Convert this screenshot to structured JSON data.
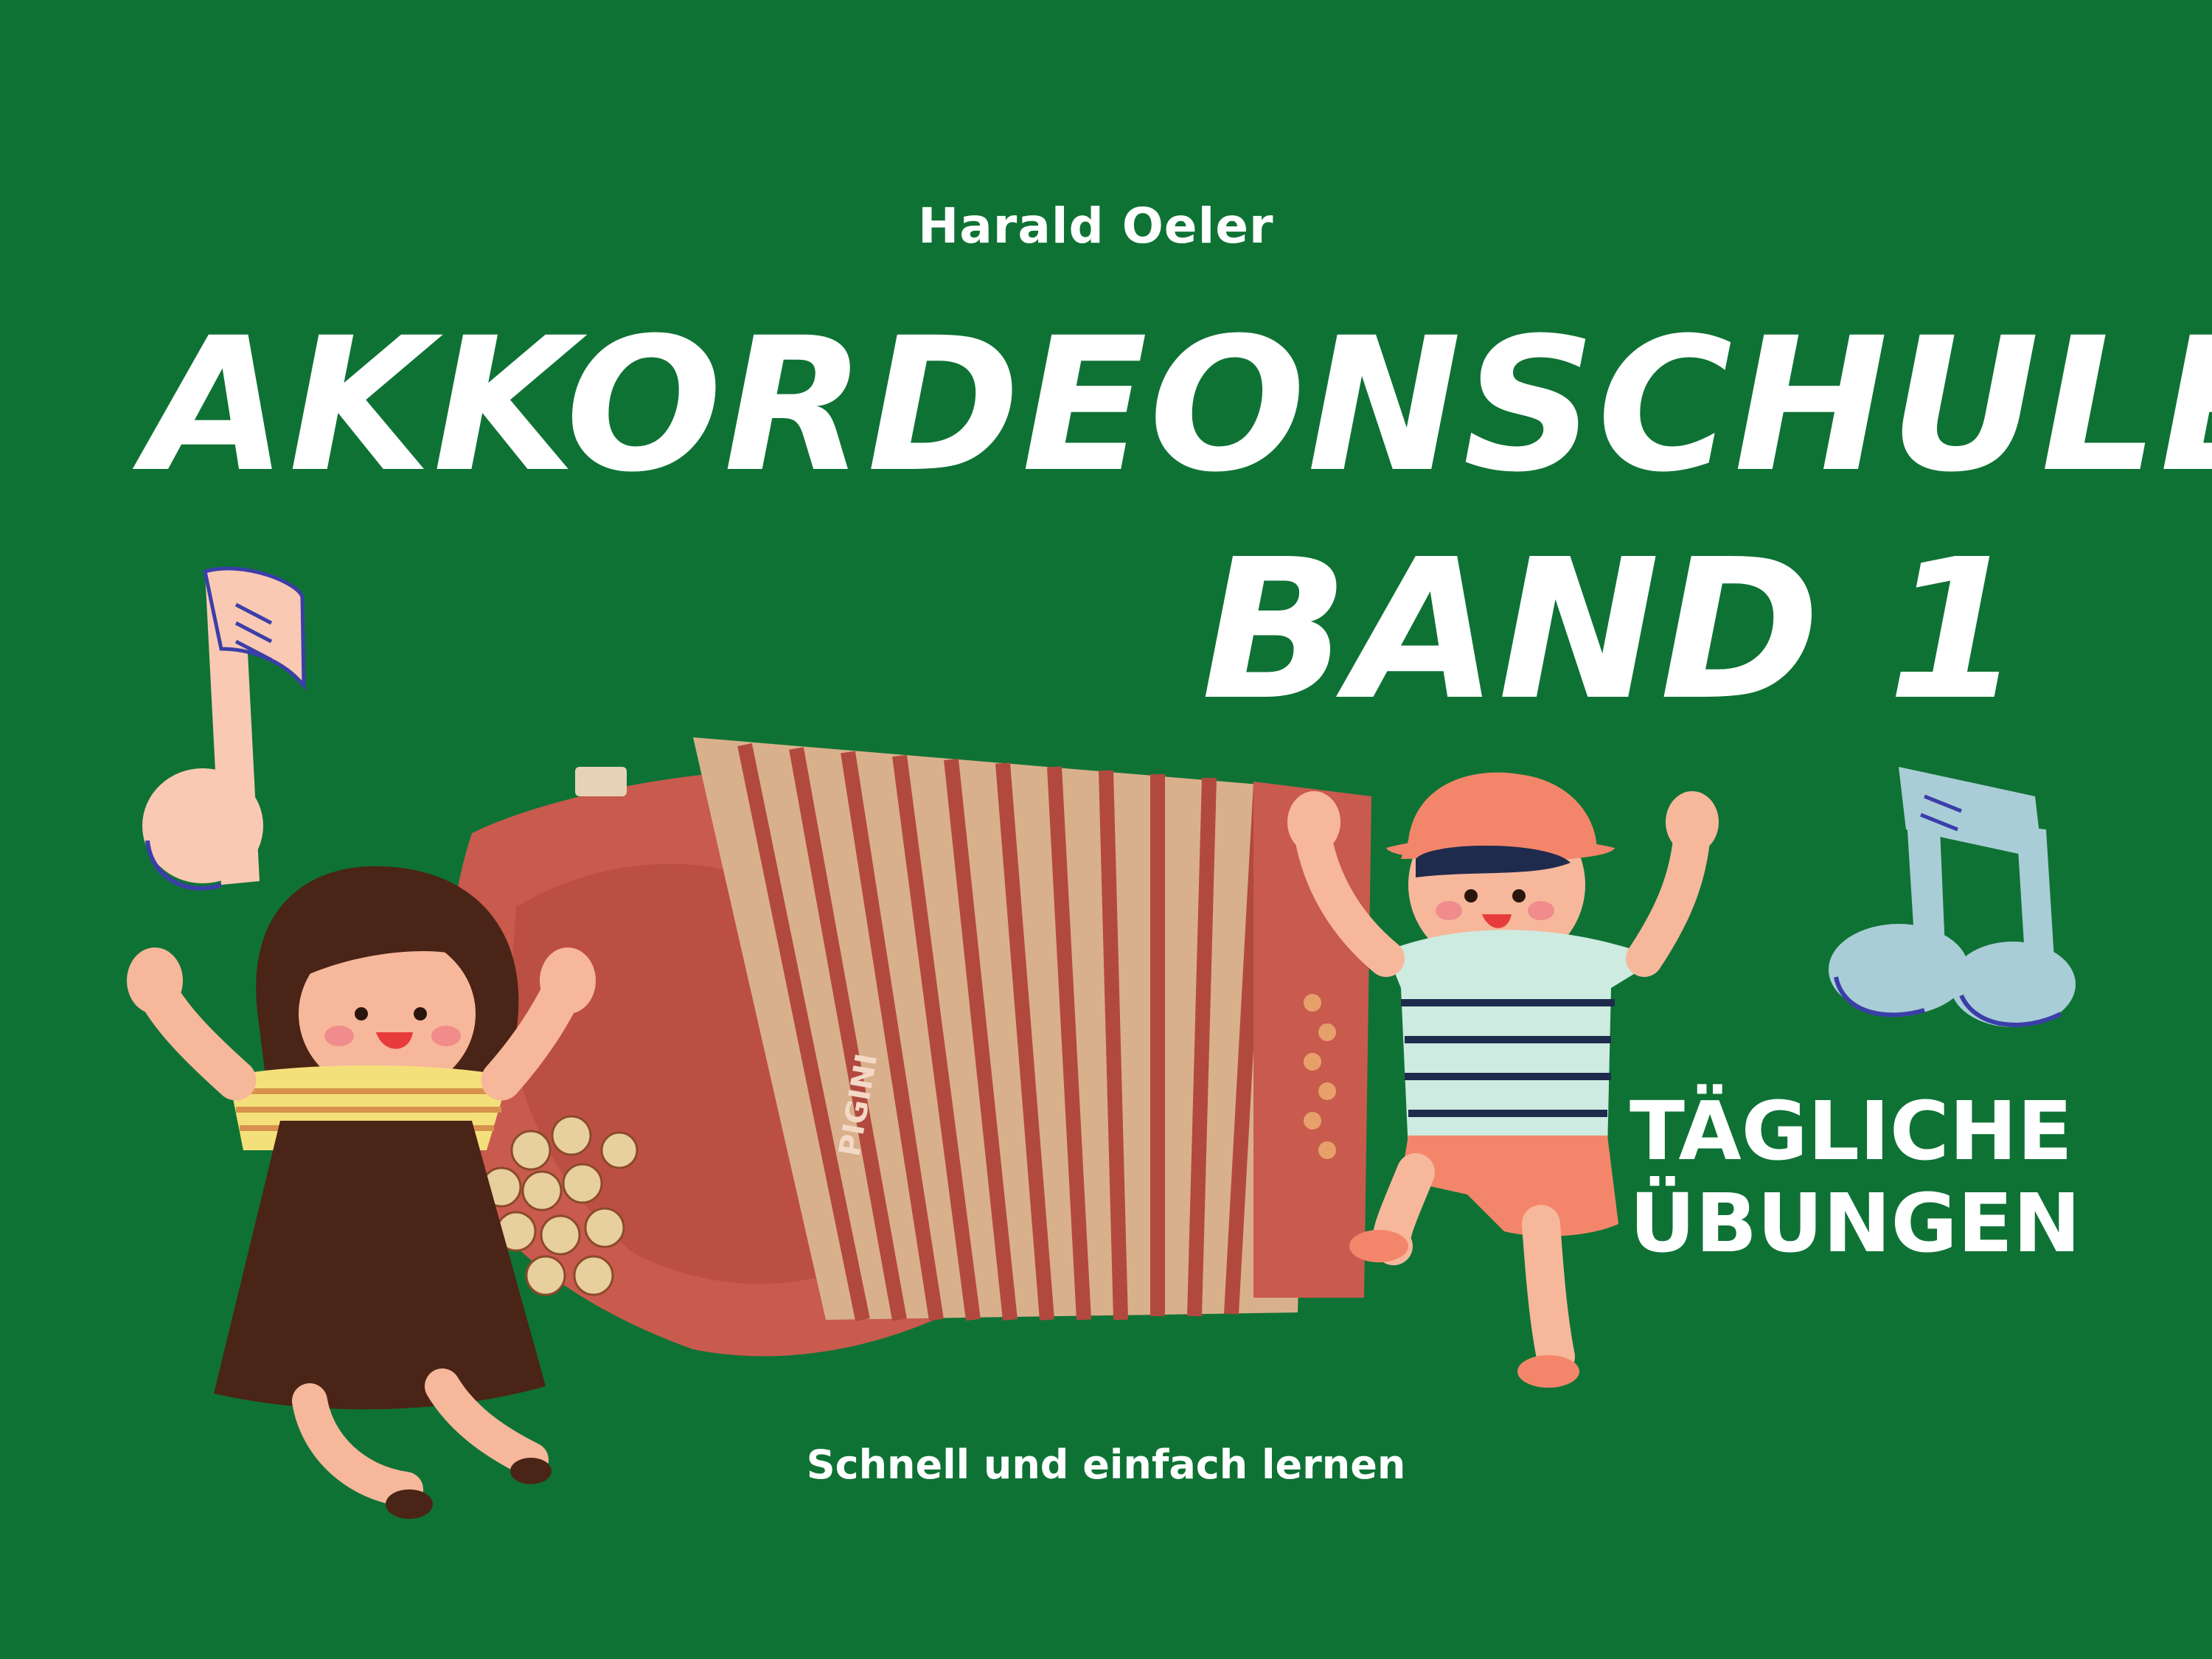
{
  "cover": {
    "author": "Harald Oeler",
    "title_line1": "AKKORDEONSCHULE",
    "title_line2": "BAND 1",
    "badge_line1": "TÄGLICHE",
    "badge_line2": "ÜBUNGEN",
    "tagline": "Schnell und einfach lernen",
    "accordion_brand": "PIGINI"
  },
  "colors": {
    "background": "#0f7235",
    "text": "#ffffff",
    "accordion_red": "#c95a4e",
    "bellows_cream": "#d9b08c",
    "note_pink": "#f9c9b3",
    "note_blue": "#a9cdd6",
    "note_outline": "#3b3ea8",
    "girl_dress": "#4a2416",
    "boy_hat": "#f3866a",
    "skin": "#f7b79b"
  },
  "icons": {
    "left_note": "eighth-note-icon",
    "right_note": "beamed-notes-icon"
  }
}
